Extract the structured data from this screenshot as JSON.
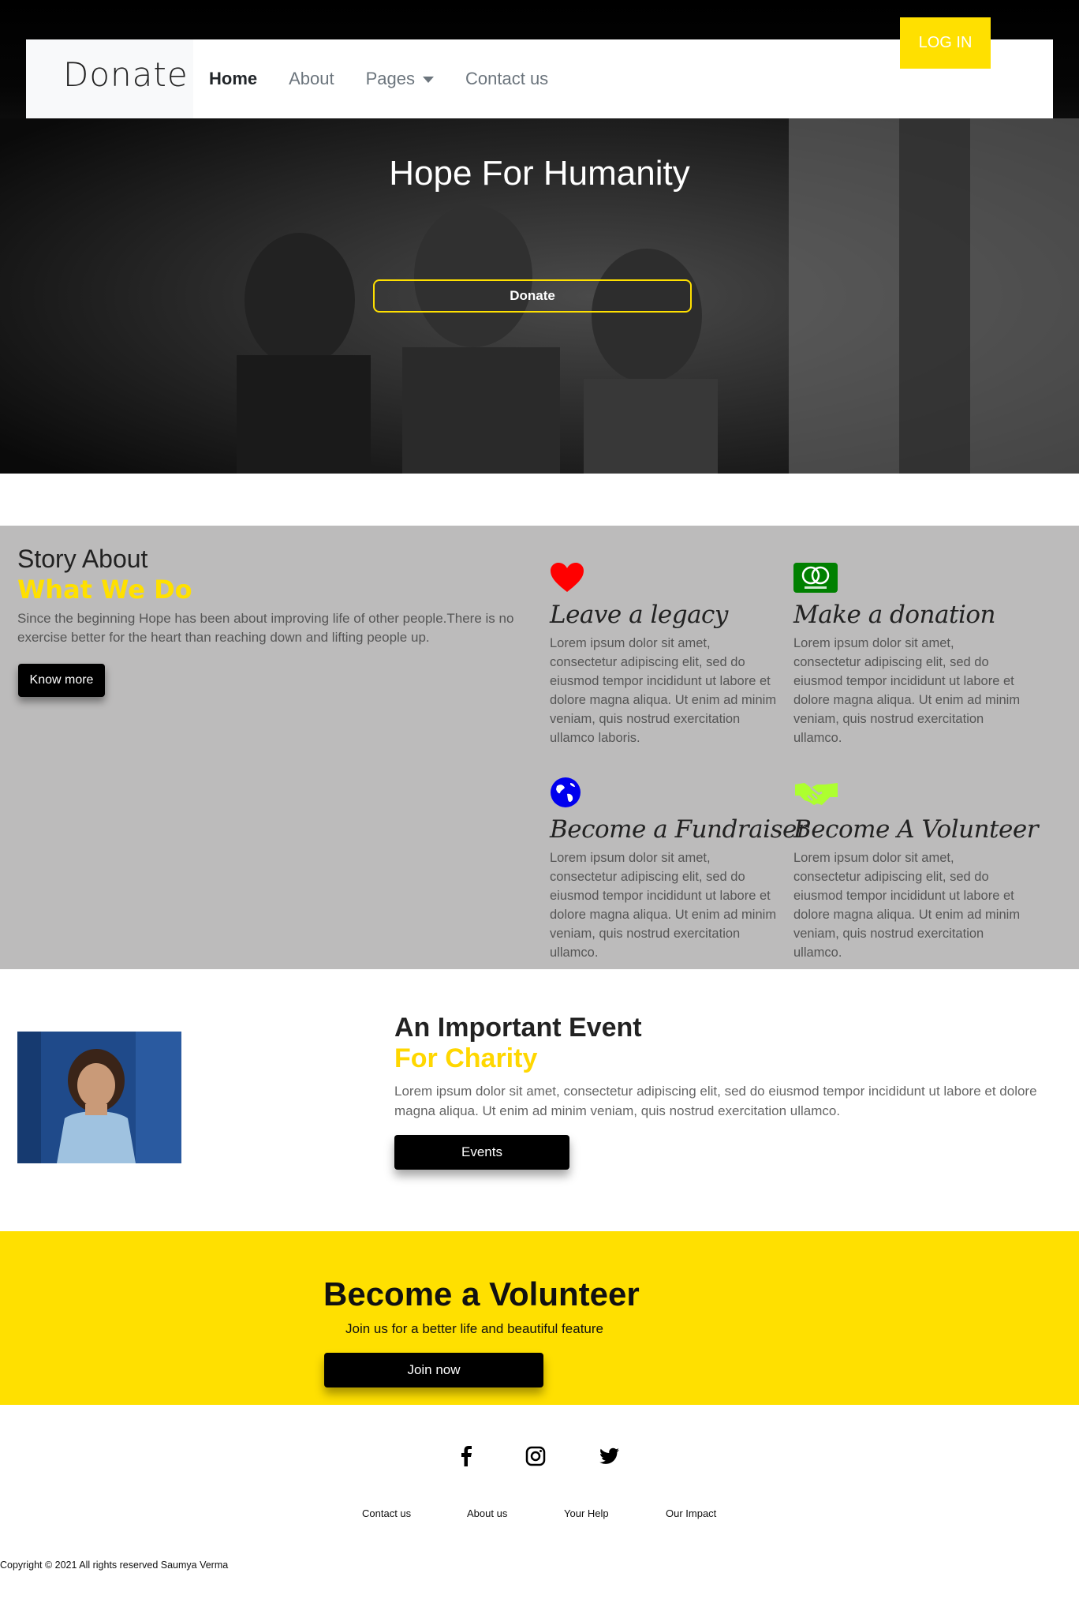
{
  "navbar": {
    "brand": "Donate",
    "links": [
      {
        "label": "Home",
        "active": true
      },
      {
        "label": "About"
      },
      {
        "label": "Pages",
        "dropdown": true
      },
      {
        "label": "Contact us"
      }
    ],
    "login_label": "LOG IN"
  },
  "hero": {
    "title": "Hope For Humanity",
    "donate_label": "Donate"
  },
  "story": {
    "title_line1": "Story About",
    "title_line2": "What We Do",
    "text": "Since the beginning Hope has been about improving life of other people.There is no exercise better for the heart than reaching down and lifting people up.",
    "button_label": "Know more",
    "features": [
      {
        "icon": "heart-icon",
        "title": "Leave a legacy",
        "text": "Lorem ipsum dolor sit amet, consectetur adipiscing elit, sed do eiusmod tempor incididunt ut labore et dolore magna aliqua. Ut enim ad minim veniam, quis nostrud exercitation ullamco laboris.",
        "color": "#ff0000"
      },
      {
        "icon": "mastercard-icon",
        "title": "Make a donation",
        "text": "Lorem ipsum dolor sit amet, consectetur adipiscing elit, sed do eiusmod tempor incididunt ut labore et dolore magna aliqua. Ut enim ad minim veniam, quis nostrud exercitation ullamco.",
        "color": "#008000"
      },
      {
        "icon": "globe-icon",
        "title": "Become a Fundraiser",
        "text": "Lorem ipsum dolor sit amet, consectetur adipiscing elit, sed do eiusmod tempor incididunt ut labore et dolore magna aliqua. Ut enim ad minim veniam, quis nostrud exercitation ullamco.",
        "color": "#0000ee"
      },
      {
        "icon": "handshake-icon",
        "title": "Become A Volunteer",
        "text": "Lorem ipsum dolor sit amet, consectetur adipiscing elit, sed do eiusmod tempor incididunt ut labore et dolore magna aliqua. Ut enim ad minim veniam, quis nostrud exercitation ullamco.",
        "color": "#adff2f"
      }
    ]
  },
  "event": {
    "title_line1": "An Important Event",
    "title_line2": "For Charity",
    "text": "Lorem ipsum dolor sit amet, consectetur adipiscing elit, sed do eiusmod tempor incididunt ut labore et dolore magna aliqua. Ut enim ad minim veniam, quis nostrud exercitation ullamco.",
    "button_label": "Events"
  },
  "volunteer": {
    "title": "Become a Volunteer",
    "subtitle": "Join us for a better life and beautiful feature",
    "button_label": "Join now"
  },
  "footer": {
    "social": [
      "facebook-icon",
      "instagram-icon",
      "twitter-icon"
    ],
    "links": [
      "Contact us",
      "About us",
      "Your Help",
      "Our Impact"
    ],
    "copyright": "Copyright © 2021 All rights reserved Saumya Verma"
  },
  "colors": {
    "accent": "#ffe000",
    "story_bg": "#bcbbbb",
    "dark": "#000000"
  }
}
